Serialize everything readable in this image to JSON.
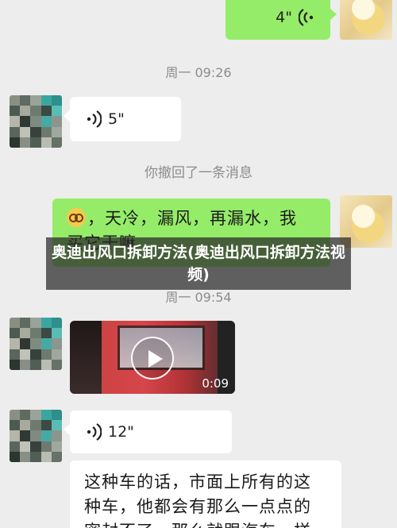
{
  "messages": {
    "voice_4": {
      "duration": "4\""
    },
    "timestamp_1": "周一 09:26",
    "voice_5": {
      "duration": "5\""
    },
    "recall_notice": "你撤回了一条消息",
    "text_cold": {
      "line1": "，天冷，漏风，再漏水，我",
      "line2": "买它干嘛"
    },
    "timestamp_2": "周一 09:54",
    "video": {
      "duration": "0:09"
    },
    "voice_12": {
      "duration": "12\""
    },
    "text_long": {
      "line1": "这种车的话，市面上所有的这",
      "line2": "种车，他都会有那么一点点的",
      "line3": "密封不了，那么就跟汽车一样"
    }
  },
  "overlay_title": "奥迪出风口拆卸方法(奥迪出风口拆卸方法视频)",
  "colors": {
    "chat_bg": "#ededed",
    "sent_bubble": "#95ec69",
    "received_bubble": "#ffffff",
    "meta_text": "#8c8c8c"
  },
  "icons": [
    "voice-wave-icon",
    "emoji-dizzy-icon",
    "play-icon"
  ]
}
